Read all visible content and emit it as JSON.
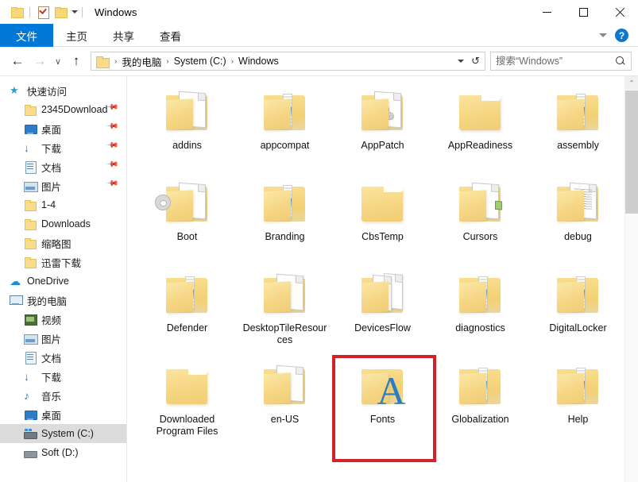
{
  "window": {
    "title": "Windows",
    "quick_access_icons": [
      "folder-icon",
      "properties-icon",
      "new-folder-icon"
    ],
    "controls": {
      "minimize": "─",
      "maximize": "□",
      "close": "✕"
    }
  },
  "ribbon": {
    "tabs": [
      {
        "label": "文件",
        "active": true
      },
      {
        "label": "主页",
        "active": false
      },
      {
        "label": "共享",
        "active": false
      },
      {
        "label": "查看",
        "active": false
      }
    ],
    "expand_caret": "chevron-down-icon",
    "help": "?"
  },
  "address": {
    "back": "←",
    "forward": "→",
    "recent": "∨",
    "up": "↑",
    "breadcrumbs": [
      "我的电脑",
      "System (C:)",
      "Windows"
    ],
    "separator": "›",
    "dropdown": "chevron-down-icon",
    "refresh": "↻"
  },
  "search": {
    "placeholder": "搜索“Windows”",
    "value": ""
  },
  "sidebar": {
    "items": [
      {
        "label": "快速访问",
        "icon": "ic-star",
        "level": 0,
        "pin": false,
        "selected": false
      },
      {
        "label": "2345Download",
        "icon": "ic-folder",
        "level": 1,
        "pin": true,
        "selected": false
      },
      {
        "label": "桌面",
        "icon": "ic-desktop",
        "level": 1,
        "pin": true,
        "selected": false
      },
      {
        "label": "下载",
        "icon": "ic-down",
        "level": 1,
        "pin": true,
        "selected": false
      },
      {
        "label": "文档",
        "icon": "ic-doc",
        "level": 1,
        "pin": true,
        "selected": false
      },
      {
        "label": "图片",
        "icon": "ic-pic",
        "level": 1,
        "pin": true,
        "selected": false
      },
      {
        "label": "1-4",
        "icon": "ic-folder",
        "level": 1,
        "pin": false,
        "selected": false
      },
      {
        "label": "Downloads",
        "icon": "ic-folder",
        "level": 1,
        "pin": false,
        "selected": false
      },
      {
        "label": "缩略图",
        "icon": "ic-folder",
        "level": 1,
        "pin": false,
        "selected": false
      },
      {
        "label": "迅雷下载",
        "icon": "ic-folder",
        "level": 1,
        "pin": false,
        "selected": false
      },
      {
        "label": "OneDrive",
        "icon": "ic-cloud",
        "level": 0,
        "pin": false,
        "selected": false
      },
      {
        "label": "我的电脑",
        "icon": "ic-pc",
        "level": 0,
        "pin": false,
        "selected": false
      },
      {
        "label": "视频",
        "icon": "ic-video",
        "level": 1,
        "pin": false,
        "selected": false
      },
      {
        "label": "图片",
        "icon": "ic-pic",
        "level": 1,
        "pin": false,
        "selected": false
      },
      {
        "label": "文档",
        "icon": "ic-doc",
        "level": 1,
        "pin": false,
        "selected": false
      },
      {
        "label": "下载",
        "icon": "ic-down",
        "level": 1,
        "pin": false,
        "selected": false
      },
      {
        "label": "音乐",
        "icon": "ic-music",
        "level": 1,
        "pin": false,
        "selected": false
      },
      {
        "label": "桌面",
        "icon": "ic-desktop",
        "level": 1,
        "pin": false,
        "selected": false
      },
      {
        "label": "System (C:)",
        "icon": "ic-drive",
        "level": 1,
        "pin": false,
        "selected": true
      },
      {
        "label": "Soft (D:)",
        "icon": "ic-drive2",
        "level": 1,
        "pin": false,
        "selected": false
      }
    ]
  },
  "content": {
    "items": [
      {
        "name": "addins",
        "art": "open-sheet"
      },
      {
        "name": "appcompat",
        "art": "open-strip"
      },
      {
        "name": "AppPatch",
        "art": "open-gears"
      },
      {
        "name": "AppReadiness",
        "art": "plain"
      },
      {
        "name": "assembly",
        "art": "open-strip"
      },
      {
        "name": "Boot",
        "art": "open-gear-single"
      },
      {
        "name": "Branding",
        "art": "open-strip"
      },
      {
        "name": "CbsTemp",
        "art": "plain"
      },
      {
        "name": "Cursors",
        "art": "open-cursor"
      },
      {
        "name": "debug",
        "art": "open-lines"
      },
      {
        "name": "Defender",
        "art": "open-strip"
      },
      {
        "name": "DesktopTileResources",
        "art": "open-sheet"
      },
      {
        "name": "DevicesFlow",
        "art": "open-twosheet"
      },
      {
        "name": "diagnostics",
        "art": "open-strip"
      },
      {
        "name": "DigitalLocker",
        "art": "open-strip"
      },
      {
        "name": "Downloaded Program Files",
        "art": "plain"
      },
      {
        "name": "en-US",
        "art": "open-sheet"
      },
      {
        "name": "Fonts",
        "art": "fonts-a",
        "highlighted": true
      },
      {
        "name": "Globalization",
        "art": "open-strip"
      },
      {
        "name": "Help",
        "art": "open-strip"
      }
    ],
    "highlight_color": "#d42027"
  },
  "scrollbar": {
    "up_arrow": "⌃"
  }
}
